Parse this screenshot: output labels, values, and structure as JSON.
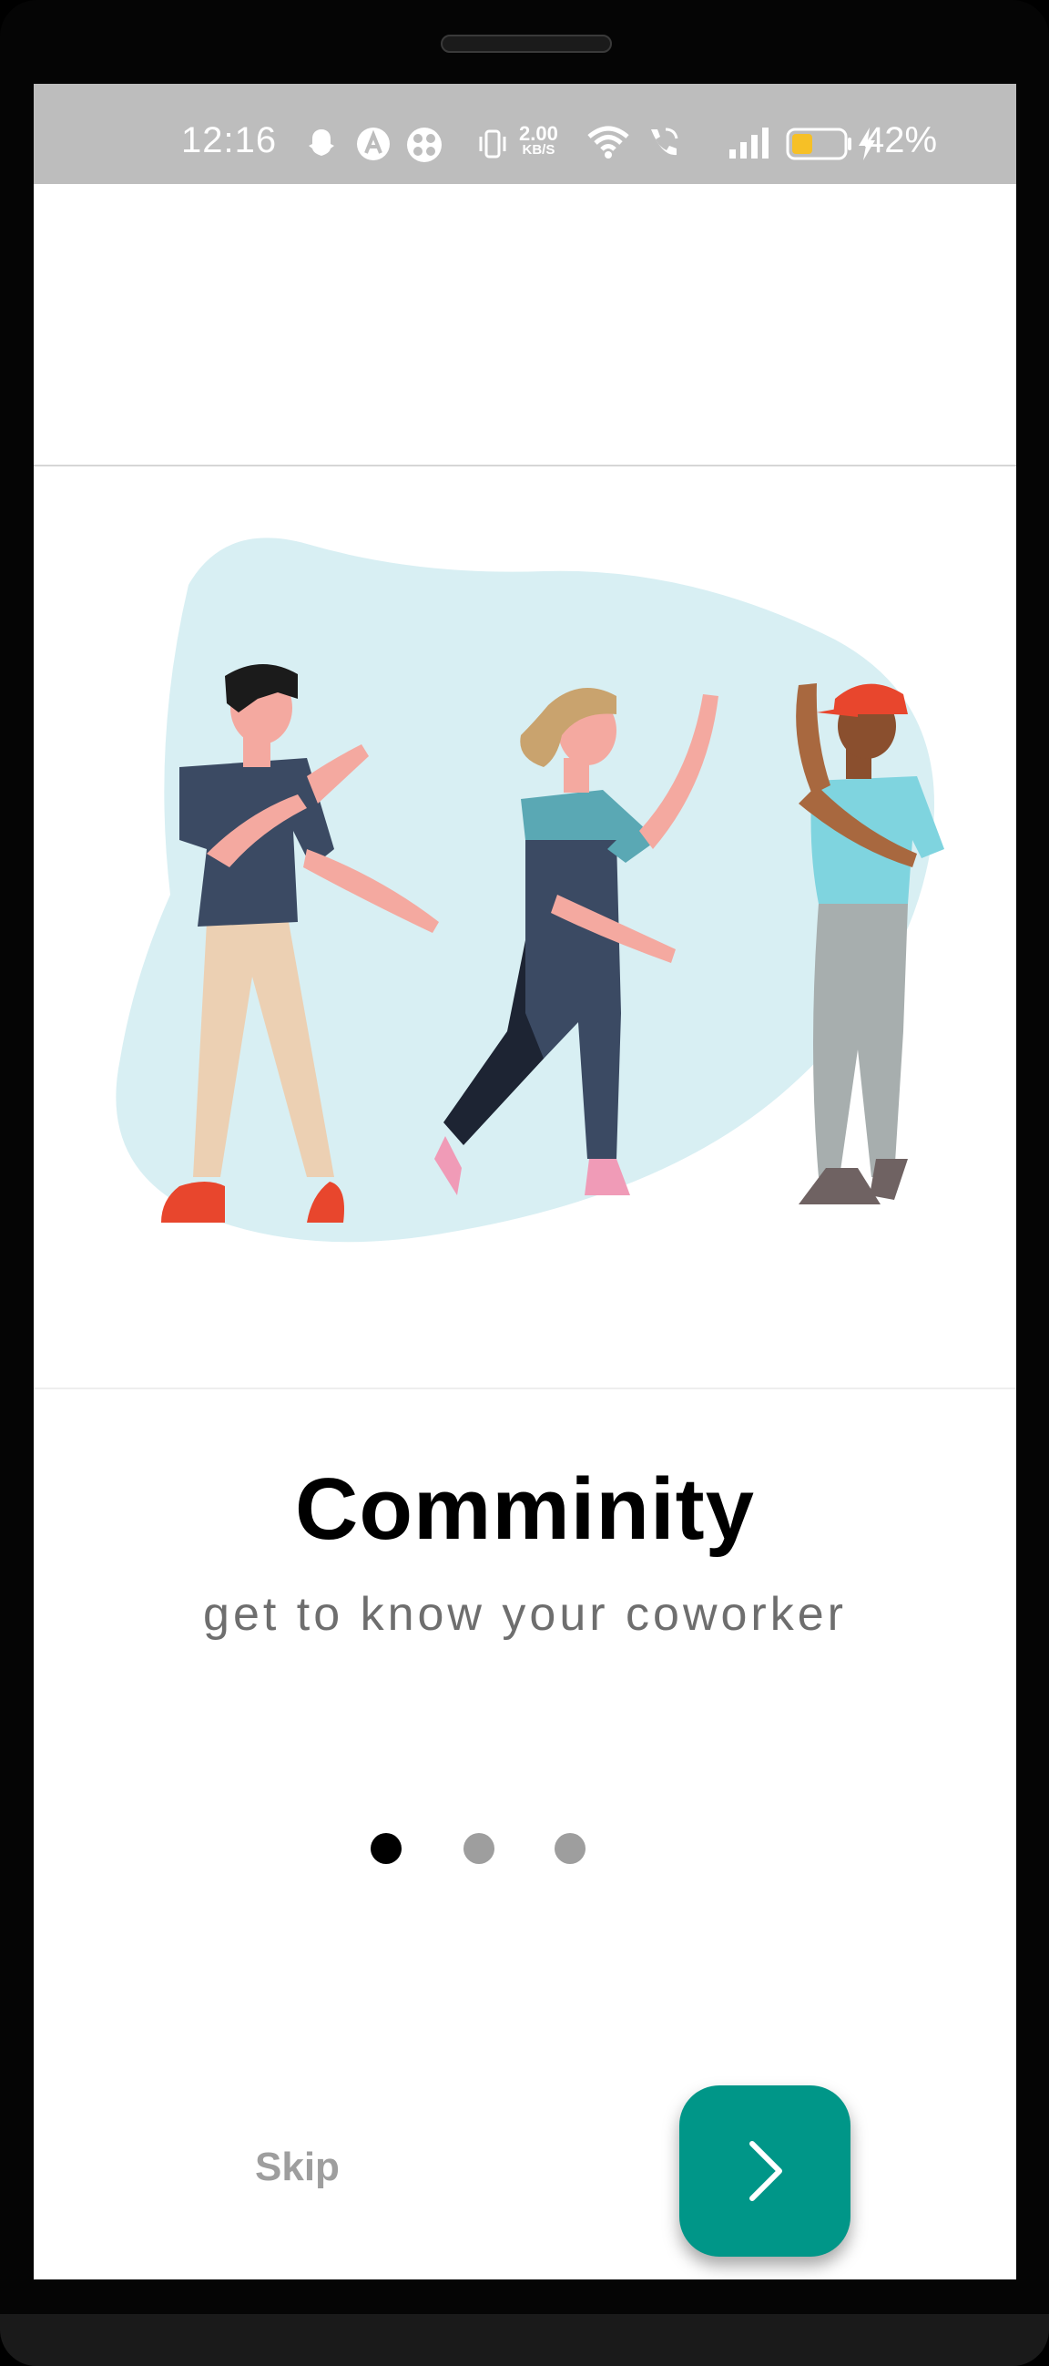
{
  "status_bar": {
    "time": "12:16",
    "net_speed_value": "2.00",
    "net_speed_unit": "KB/S",
    "battery_percent": "42%",
    "icons": [
      "snapchat-icon",
      "app-a-icon",
      "app-grid-icon",
      "vibrate-icon",
      "wifi-icon",
      "wifi-call-icon",
      "signal-icon",
      "battery-icon",
      "charging-icon"
    ]
  },
  "onboarding": {
    "title": "Comminity",
    "subtitle": "get to know your coworker",
    "page_count": 3,
    "current_page": 1,
    "skip_label": "Skip",
    "next_icon": "chevron-right-icon"
  },
  "colors": {
    "accent": "#009688",
    "status_bar": "#bdbdbd",
    "blob": "#d8eff3",
    "dot_active": "#000000",
    "dot_inactive": "#9e9e9e"
  }
}
